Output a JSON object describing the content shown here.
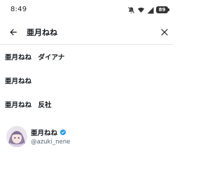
{
  "status_bar": {
    "time": "8:49",
    "battery_level": "89",
    "icons": [
      "mute-icon",
      "wifi-icon",
      "signal-icon",
      "battery-icon"
    ]
  },
  "search": {
    "query": "亜月ねね",
    "back_icon": "arrow-left-icon",
    "clear_icon": "close-icon"
  },
  "suggestions": [
    {
      "text": "亜月ねね　ダイアナ"
    },
    {
      "text": "亜月ねね"
    },
    {
      "text": "亜月ねね　反社"
    }
  ],
  "user_result": {
    "name": "亜月ねね",
    "handle": "@azuki_nene",
    "verified": true,
    "verified_color": "#1d9bf0"
  }
}
